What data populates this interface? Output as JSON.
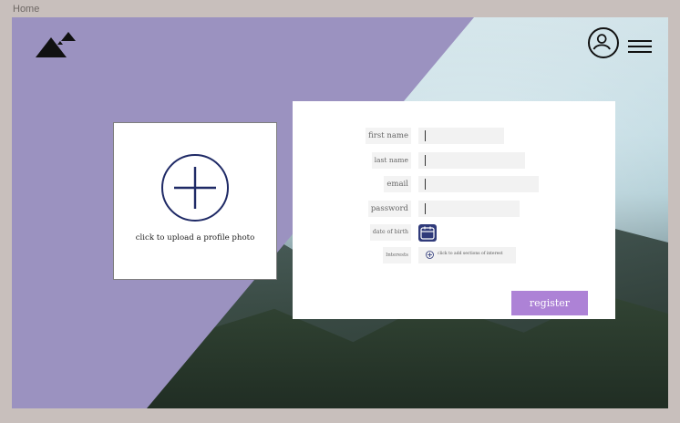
{
  "header": {
    "tab_label": "Home"
  },
  "photo_upload": {
    "caption": "click to upload a profile photo",
    "icon": "plus-circle-icon"
  },
  "form": {
    "fields": [
      {
        "label": "first name"
      },
      {
        "label": "last name"
      },
      {
        "label": "email"
      },
      {
        "label": "password"
      },
      {
        "label": "date of birth"
      },
      {
        "label": "Interests"
      }
    ],
    "interests_placeholder": "click to add sections of interest",
    "register_label": "register"
  },
  "colors": {
    "purple_overlay": "#9b92c0",
    "register_button": "#ad82d6",
    "calendar_icon": "#2f3a7a",
    "plus_icon": "#1f2a66"
  }
}
